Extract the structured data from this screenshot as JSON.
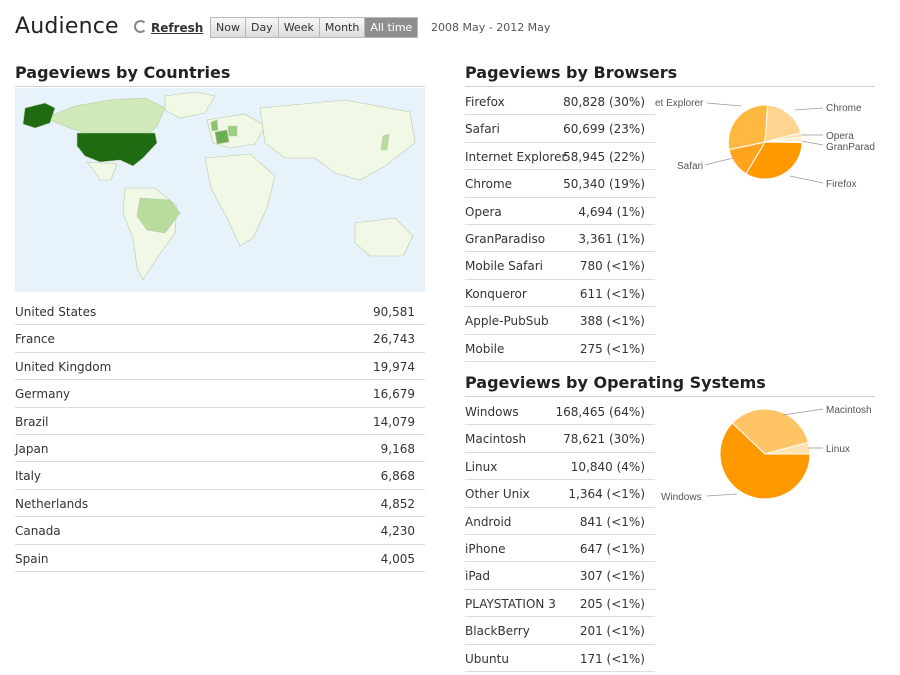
{
  "header": {
    "title": "Audience",
    "refresh_label": "Refresh",
    "ranges": [
      "Now",
      "Day",
      "Week",
      "Month",
      "All time"
    ],
    "active_range": "All time",
    "date_range": "2008 May - 2012 May"
  },
  "countries": {
    "title": "Pageviews by Countries",
    "rows": [
      {
        "name": "United States",
        "value": "90,581"
      },
      {
        "name": "France",
        "value": "26,743"
      },
      {
        "name": "United Kingdom",
        "value": "19,974"
      },
      {
        "name": "Germany",
        "value": "16,679"
      },
      {
        "name": "Brazil",
        "value": "14,079"
      },
      {
        "name": "Japan",
        "value": "9,168"
      },
      {
        "name": "Italy",
        "value": "6,868"
      },
      {
        "name": "Netherlands",
        "value": "4,852"
      },
      {
        "name": "Canada",
        "value": "4,230"
      },
      {
        "name": "Spain",
        "value": "4,005"
      }
    ]
  },
  "browsers": {
    "title": "Pageviews by Browsers",
    "rows": [
      {
        "name": "Firefox",
        "value": "80,828 (30%)"
      },
      {
        "name": "Safari",
        "value": "60,699 (23%)"
      },
      {
        "name": "Internet Explorer",
        "value": "58,945 (22%)"
      },
      {
        "name": "Chrome",
        "value": "50,340 (19%)"
      },
      {
        "name": "Opera",
        "value": "4,694 (1%)"
      },
      {
        "name": "GranParadiso",
        "value": "3,361 (1%)"
      },
      {
        "name": "Mobile Safari",
        "value": "780 (<1%)"
      },
      {
        "name": "Konqueror",
        "value": "611 (<1%)"
      },
      {
        "name": "Apple-PubSub",
        "value": "388 (<1%)"
      },
      {
        "name": "Mobile",
        "value": "275 (<1%)"
      }
    ],
    "pie_labels": [
      "et Explorer",
      "Chrome",
      "Opera",
      "GranParad",
      "Safari",
      "Firefox"
    ]
  },
  "os": {
    "title": "Pageviews by Operating Systems",
    "rows": [
      {
        "name": "Windows",
        "value": "168,465 (64%)"
      },
      {
        "name": "Macintosh",
        "value": "78,621 (30%)"
      },
      {
        "name": "Linux",
        "value": "10,840 (4%)"
      },
      {
        "name": "Other Unix",
        "value": "1,364 (<1%)"
      },
      {
        "name": "Android",
        "value": "841 (<1%)"
      },
      {
        "name": "iPhone",
        "value": "647 (<1%)"
      },
      {
        "name": "iPad",
        "value": "307 (<1%)"
      },
      {
        "name": "PLAYSTATION 3",
        "value": "205 (<1%)"
      },
      {
        "name": "BlackBerry",
        "value": "201 (<1%)"
      },
      {
        "name": "Ubuntu",
        "value": "171 (<1%)"
      }
    ],
    "pie_labels": [
      "Macintosh",
      "Linux",
      "Windows"
    ]
  },
  "colors": {
    "map_ocean": "#e8f2fb",
    "map_land": "#f2f8e6",
    "map_dark": "#1f6b12",
    "pie_orange": "#ff9900",
    "pie_light": "#ffcc77"
  }
}
